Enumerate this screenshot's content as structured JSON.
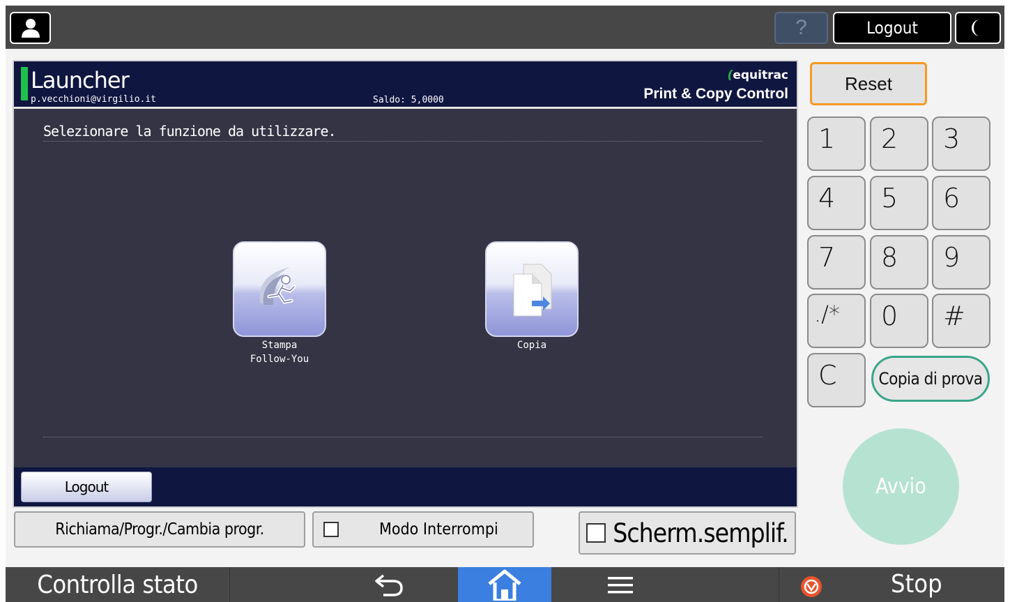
{
  "topbar": {
    "help_label": "?",
    "logout_label": "Logout"
  },
  "app": {
    "title": "Launcher",
    "user": "p.vecchioni@virgilio.it",
    "balance": "Saldo: 5,0000",
    "brand_top": "equitrac",
    "brand_bottom": "Print & Copy Control",
    "instruction": "Selezionare la funzione da utilizzare.",
    "tiles": [
      {
        "label_line1": "Stampa",
        "label_line2": "Follow-You",
        "icon": "follow-you-runner-icon"
      },
      {
        "label_line1": "Copia",
        "label_line2": "",
        "icon": "copy-documents-icon"
      }
    ],
    "footer_logout": "Logout"
  },
  "bottom_buttons": {
    "recall": "Richiama/Progr./Cambia progr.",
    "interrupt": "Modo Interrompi",
    "simple_screen": "Scherm.semplif."
  },
  "keypad": {
    "reset": "Reset",
    "keys": [
      "1",
      "2",
      "3",
      "4",
      "5",
      "6",
      "7",
      "8",
      "9",
      "./*",
      "0",
      "#",
      "C"
    ],
    "proof_copy": "Copia di prova",
    "start": "Avvio"
  },
  "system_bar": {
    "status": "Controlla stato",
    "stop": "Stop"
  },
  "colors": {
    "reset_border": "#f59a22",
    "start_button": "#b6e2d2",
    "home_active": "#3b7fe0",
    "stop_icon": "#e8542e",
    "header_bg": "#0f1640",
    "green_accent": "#1fbf4d"
  }
}
